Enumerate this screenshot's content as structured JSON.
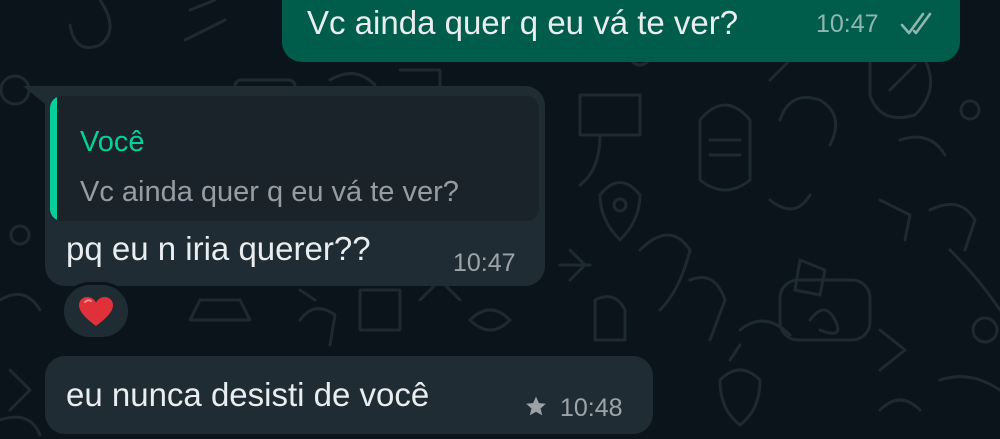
{
  "messages": [
    {
      "direction": "outgoing",
      "text": "Vc ainda quer q eu vá te ver?",
      "time": "10:47",
      "status": "read",
      "status_icon": "double-check-icon"
    },
    {
      "direction": "incoming",
      "reply_to": {
        "author": "Você",
        "text": "Vc ainda quer q eu vá te ver?"
      },
      "text": "pq eu n iria querer??",
      "time": "10:47",
      "reaction": "heart-emoji"
    },
    {
      "direction": "incoming",
      "text": "eu nunca desisti de você",
      "time": "10:48",
      "starred": true,
      "star_icon": "star-icon"
    }
  ],
  "colors": {
    "background": "#0b141a",
    "outgoing_bubble": "#005c4b",
    "incoming_bubble": "#202c33",
    "quote_accent": "#06cf9c",
    "text": "#e9edef",
    "reaction_heart": "#e0303a"
  }
}
